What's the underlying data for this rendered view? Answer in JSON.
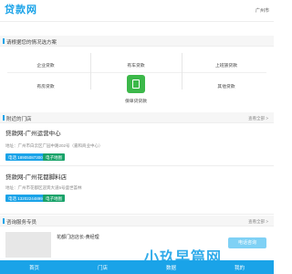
{
  "header": {
    "logo": "贷款网",
    "city": "广州市"
  },
  "loan_section": {
    "title": "请根据您的情况选方案",
    "items": [
      "企业贷款",
      "有车贷款",
      "上班族贷款",
      "有房贷款",
      "保单贷贷款",
      "其他贷款"
    ]
  },
  "stores_section": {
    "title": "附近的门店",
    "more": "查看全部 >",
    "stores": [
      {
        "name": "贷款网-广州运营中心",
        "address": "地址：广州市白云区广园中路202号（嘉和商业中心）",
        "phone": "电话 18905087300",
        "map": "电子地图"
      },
      {
        "name": "贷款网-广州花都脚料店",
        "address": "地址：广州市花都区迎宾大道5号盛世荟林",
        "phone": "电话 13202244899",
        "map": "电子地图"
      }
    ]
  },
  "advisor_section": {
    "title": "咨询服务专员",
    "more": "查看全部 >",
    "name": "花都门店店长-黄经理",
    "consult": "电话咨询"
  },
  "watermark": "小玖早篇网",
  "bottom_nav": [
    "首页",
    "门店",
    "数据",
    "我的"
  ],
  "colors": {
    "accent": "#1aa3e8",
    "green": "#19a36a",
    "special_icon": "#3cb84a"
  }
}
